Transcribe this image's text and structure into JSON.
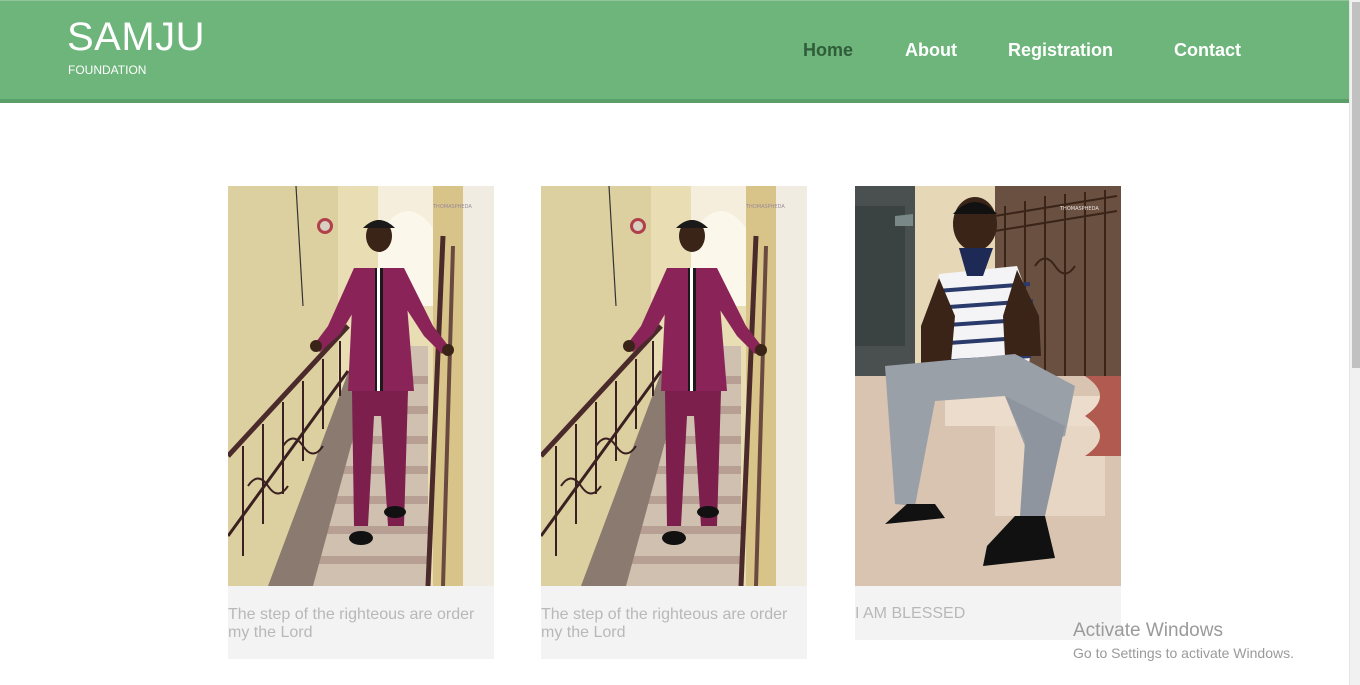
{
  "header": {
    "logo_title": "SAMJU",
    "logo_subtitle": "FOUNDATION",
    "nav": {
      "home": "Home",
      "about": "About",
      "registration": "Registration",
      "contact": "Contact"
    },
    "active_nav": "home"
  },
  "cards": [
    {
      "caption": "The step of the righteous are order my the Lord",
      "photo": "man-on-stairs-purple-outfit"
    },
    {
      "caption": "The step of the righteous are order my the Lord",
      "photo": "man-on-stairs-purple-outfit"
    },
    {
      "caption": "I AM BLESSED",
      "photo": "man-seated-striped-polo"
    }
  ],
  "watermark": {
    "title": "Activate Windows",
    "subtitle": "Go to Settings to activate Windows."
  },
  "colors": {
    "header_bg": "#6db57a",
    "nav_active": "#2f5d3a",
    "caption_text": "#b8b8b8",
    "card_bg": "#f3f3f3"
  }
}
